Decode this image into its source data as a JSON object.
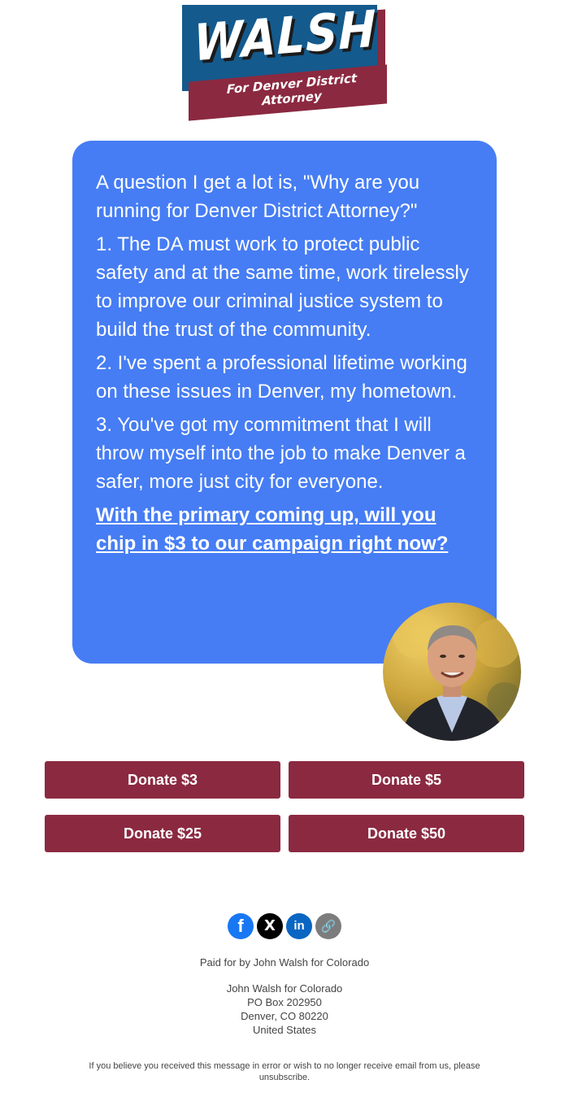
{
  "logo": {
    "name": "WALSH",
    "subtitle": "For Denver District Attorney",
    "colors": {
      "blue": "#145a8d",
      "maroon": "#8b2940"
    }
  },
  "message": {
    "intro": "A question I get a lot is, \"Why are you running for Denver District Attorney?\"",
    "points": [
      "1. The DA must work to protect public safety and at the same time, work tirelessly to improve our criminal justice system to build the trust of the community.",
      "2. I've spent a professional lifetime working on these issues in Denver, my hometown.",
      "3. You've got my commitment that I will throw myself into the job to make Denver a safer, more just city for everyone."
    ],
    "ask_link": "With the primary coming up, will you chip in $3 to our campaign right now?",
    "bubble_color": "#467df4"
  },
  "donate_buttons": [
    {
      "label": "Donate $3"
    },
    {
      "label": "Donate $5"
    },
    {
      "label": "Donate $25"
    },
    {
      "label": "Donate $50"
    }
  ],
  "button_color": "#8b2940",
  "social": [
    {
      "icon": "facebook-icon",
      "glyph": "f",
      "color": "#1877f2"
    },
    {
      "icon": "x-icon",
      "glyph": "X",
      "color": "#000000"
    },
    {
      "icon": "linkedin-icon",
      "glyph": "in",
      "color": "#0a66c2"
    },
    {
      "icon": "link-icon",
      "glyph": "🔗",
      "color": "#7c7c7c"
    }
  ],
  "footer": {
    "paid_for": "Paid for by John Walsh for Colorado",
    "address": {
      "line1": "John Walsh for Colorado",
      "line2": "PO Box 202950",
      "line3": "Denver, CO 80220",
      "line4": "United States"
    },
    "unsubscribe_line1": "If you believe you received this message in error or wish to no longer receive email from us, please",
    "unsubscribe_line2": "unsubscribe."
  }
}
